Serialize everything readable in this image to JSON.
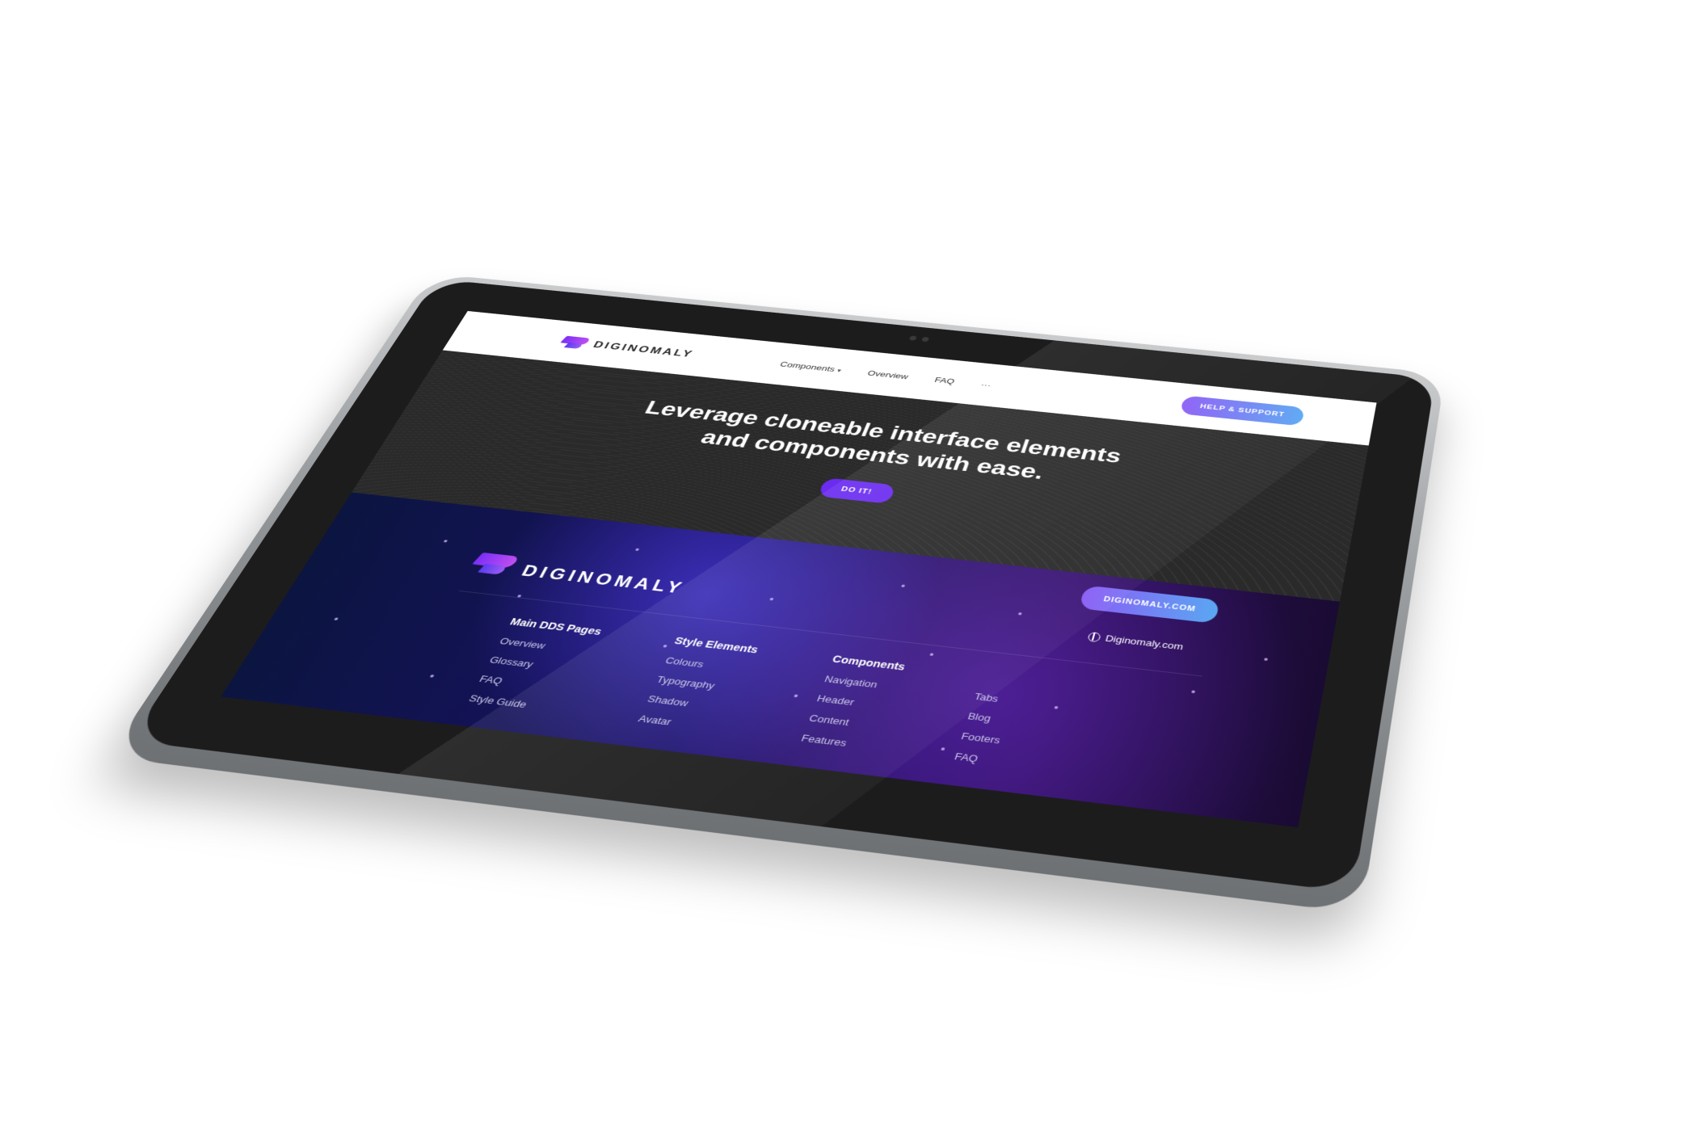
{
  "site": {
    "brand": "DIGINOMALY",
    "colors": {
      "accent": "#6b2cf0",
      "gradient_start": "#8a5cf6",
      "gradient_end": "#5aa7f2",
      "hero_bg": "#2a2a2b",
      "footer_bg": "#1a1066"
    }
  },
  "nav": {
    "links": [
      {
        "label": "Components",
        "has_dropdown": true
      },
      {
        "label": "Overview"
      },
      {
        "label": "FAQ"
      },
      {
        "label": "···"
      }
    ],
    "help_button": "HELP & SUPPORT"
  },
  "hero": {
    "title_line1": "Leverage cloneable interface elements",
    "title_line2": "and components with ease.",
    "cta": "DO IT!"
  },
  "footer": {
    "brand": "DIGINOMALY",
    "site_button": "DIGINOMALY.COM",
    "site_link": "Diginomaly.com",
    "columns": [
      {
        "heading": "Main DDS Pages",
        "items": [
          "Overview",
          "Glossary",
          "FAQ",
          "Style Guide"
        ]
      },
      {
        "heading": "Style Elements",
        "items": [
          "Colours",
          "Typography",
          "Shadow",
          "Avatar"
        ]
      },
      {
        "heading": "Components",
        "items": [
          "Navigation",
          "Header",
          "Content",
          "Features"
        ]
      },
      {
        "heading": "",
        "items": [
          "Tabs",
          "Blog",
          "Footers",
          "FAQ"
        ]
      }
    ]
  }
}
